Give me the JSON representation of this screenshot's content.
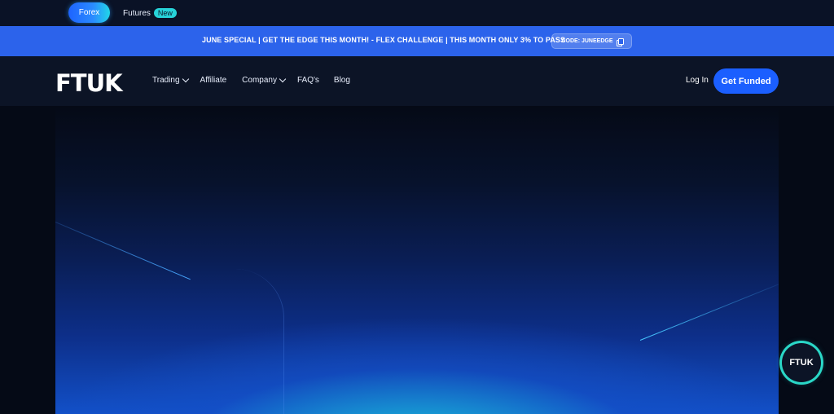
{
  "top_tabs": {
    "forex": "Forex",
    "futures": "Futures",
    "futures_badge": "New"
  },
  "promo": {
    "text": "JUNE SPECIAL | GET THE EDGE THIS MONTH! - FLEX CHALLENGE | THIS MONTH ONLY 3% TO PASS",
    "code_label": "CODE: JUNEEDGE"
  },
  "header": {
    "logo": "FTUK",
    "nav": [
      {
        "label": "Trading",
        "dropdown": true
      },
      {
        "label": "Affiliate",
        "dropdown": false
      },
      {
        "label": "Company",
        "dropdown": true
      },
      {
        "label": "FAQ's",
        "dropdown": false
      },
      {
        "label": "Blog",
        "dropdown": false
      }
    ],
    "login": "Log In",
    "cta": "Get Funded"
  },
  "chat_widget": {
    "label": "FTUK"
  },
  "colors": {
    "promo_bg": "#2c63eb",
    "cta_bg": "#1b5fff",
    "accent_cyan": "#27d3d9"
  }
}
